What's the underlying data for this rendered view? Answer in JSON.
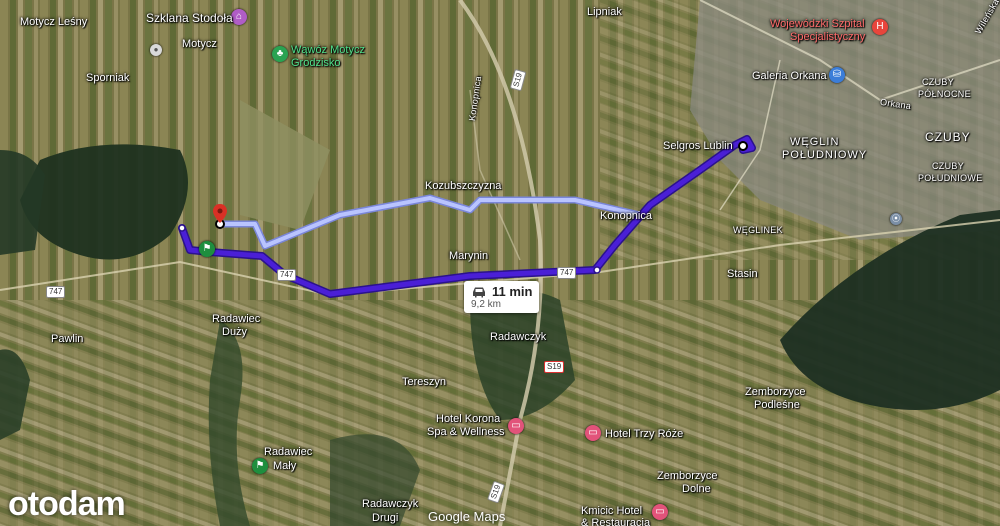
{
  "map": {
    "places": [
      {
        "id": "motycz-lesny",
        "text": "Motycz Leśny"
      },
      {
        "id": "szklana-stodola",
        "text": "Szklana Stodoła"
      },
      {
        "id": "motycz",
        "text": "Motycz"
      },
      {
        "id": "wawoz-1",
        "text": "Wąwóz Motycz"
      },
      {
        "id": "wawoz-2",
        "text": "Grodzisko"
      },
      {
        "id": "sporniak",
        "text": "Sporniak"
      },
      {
        "id": "lipniak",
        "text": "Lipniak"
      },
      {
        "id": "szpital-1",
        "text": "Wojewódzki Szpital"
      },
      {
        "id": "szpital-2",
        "text": "Specjalistyczny"
      },
      {
        "id": "galeria",
        "text": "Galeria Orkana"
      },
      {
        "id": "czuby-polnocne-1",
        "text": "CZUBY"
      },
      {
        "id": "czuby-polnocne-2",
        "text": "PÓŁNOCNE"
      },
      {
        "id": "czuby",
        "text": "CZUBY"
      },
      {
        "id": "weglin-1",
        "text": "WĘGLIN"
      },
      {
        "id": "weglin-2",
        "text": "POŁUDNIOWY"
      },
      {
        "id": "czuby-poludniowe-1",
        "text": "CZUBY"
      },
      {
        "id": "czuby-poludniowe-2",
        "text": "POŁUDNIOWE"
      },
      {
        "id": "selgros",
        "text": "Selgros Lublin"
      },
      {
        "id": "kozubszczyzna",
        "text": "Kozubszczyzna"
      },
      {
        "id": "konopnica",
        "text": "Konopnica"
      },
      {
        "id": "weglinek",
        "text": "WĘGLINEK"
      },
      {
        "id": "marynin",
        "text": "Marynin"
      },
      {
        "id": "stasin",
        "text": "Stasin"
      },
      {
        "id": "pawlin",
        "text": "Pawlin"
      },
      {
        "id": "radawiec-duzy-1",
        "text": "Radawiec"
      },
      {
        "id": "radawiec-duzy-2",
        "text": "Duży"
      },
      {
        "id": "radawczyk",
        "text": "Radawczyk"
      },
      {
        "id": "tereszyn",
        "text": "Tereszyn"
      },
      {
        "id": "hotel-korona-1",
        "text": "Hotel Korona"
      },
      {
        "id": "hotel-korona-2",
        "text": "Spa & Wellness"
      },
      {
        "id": "hotel-trzy-roze",
        "text": "Hotel Trzy Róże"
      },
      {
        "id": "zemborzyce-podlesne-1",
        "text": "Zemborzyce"
      },
      {
        "id": "zemborzyce-podlesne-2",
        "text": "Podleśne"
      },
      {
        "id": "zemborzyce-dolne-1",
        "text": "Zemborzyce"
      },
      {
        "id": "zemborzyce-dolne-2",
        "text": "Dolne"
      },
      {
        "id": "kmicic-1",
        "text": "Kmicic Hotel"
      },
      {
        "id": "kmicic-2",
        "text": "& Restauracja"
      },
      {
        "id": "radawiec-maly-1",
        "text": "Radawiec"
      },
      {
        "id": "radawiec-maly-2",
        "text": "Mały"
      },
      {
        "id": "radawczyk-drugi-1",
        "text": "Radawczyk"
      },
      {
        "id": "radawczyk-drugi-2",
        "text": "Drugi"
      },
      {
        "id": "koronica",
        "text": "Konopnica"
      },
      {
        "id": "orkana",
        "text": "Orkana"
      },
      {
        "id": "wilenska",
        "text": "Wileńska"
      }
    ],
    "road_shields": [
      {
        "id": "r747-west",
        "text": "747"
      },
      {
        "id": "r747-mid",
        "text": "747"
      },
      {
        "id": "r747-east",
        "text": "747"
      },
      {
        "id": "s19-south",
        "text": "S19"
      },
      {
        "id": "e5-north",
        "text": "S19"
      },
      {
        "id": "s19-bottom",
        "text": "S19"
      }
    ],
    "route_info": {
      "duration": "11 min",
      "distance": "9,2 km",
      "icon": "car-icon"
    },
    "attribution": "Google Maps",
    "watermark": "otodam",
    "colors": {
      "route": "#4a1fd6",
      "alt_route": "#b9c4ff",
      "hospital": "#e8453c",
      "poi_purple": "#b05dc6",
      "poi_pink": "#e2537a",
      "park": "#2aa352",
      "start": "#1e8e3e",
      "destination": "#d93025"
    }
  }
}
